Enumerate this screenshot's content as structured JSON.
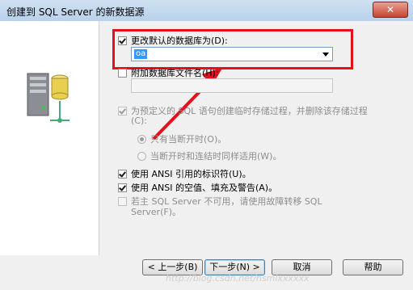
{
  "window": {
    "title": "创建到 SQL Server 的新数据源",
    "close_label": "✕"
  },
  "options": {
    "change_default_db": {
      "label": "更改默认的数据库为(D):",
      "checked": true
    },
    "database_combo": {
      "value": "oa"
    },
    "attach_db_file": {
      "label": "附加数据库文件名(H):",
      "checked": false
    },
    "temp_stored_proc": {
      "label_line1": "为预定义的 SQL 语句创建临时存储过程，并删除该存储过程",
      "label_line2": "(C):",
      "checked": true
    },
    "radio_only_disconnect": {
      "label": "只有当断开时(O)。",
      "selected": true
    },
    "radio_disconnect_and_connected": {
      "label": "当断开时和连结时同样适用(W)。",
      "selected": false
    },
    "ansi_quoted_identifiers": {
      "label": "使用 ANSI 引用的标识符(U)。",
      "checked": true
    },
    "ansi_nulls_padding": {
      "label": "使用 ANSI 的空值、填充及警告(A)。",
      "checked": true
    },
    "failover": {
      "label_line1": "若主 SQL Server 不可用，请使用故障转移 SQL",
      "label_line2": "Server(F)。",
      "checked": false
    }
  },
  "buttons": {
    "back": "< 上一步(B)",
    "next": "下一步(N) >",
    "cancel": "取消",
    "help": "帮助"
  },
  "watermark": "http://blog.csdn.net/nsmlxxxxxx"
}
